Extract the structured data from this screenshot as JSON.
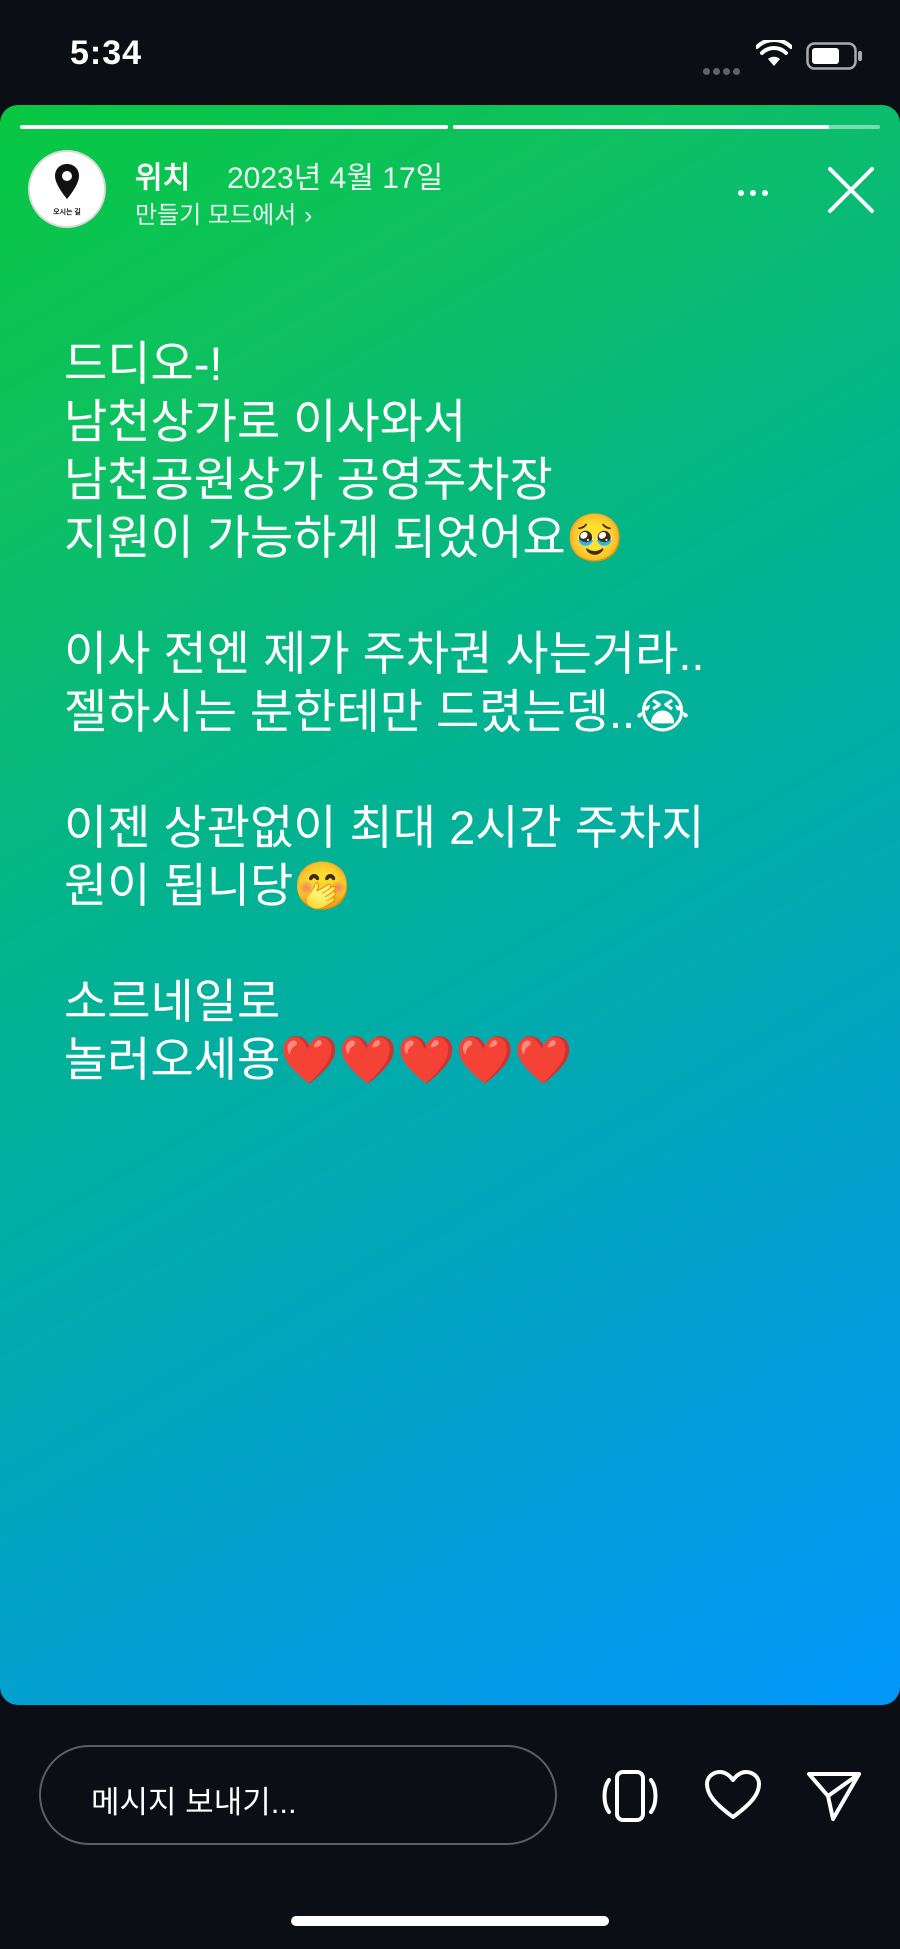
{
  "status_bar": {
    "time": "5:34"
  },
  "story": {
    "progress": [
      1.0,
      0.88
    ],
    "avatar_text": "오시는 길",
    "username": "위치",
    "date": "2023년 4월 17일",
    "subline": "만들기 모드에서",
    "lines": [
      "드디오-!",
      "남천상가로 이사와서",
      "남천공원상가 공영주차장",
      "지원이 가능하게 되었어요🥹",
      "",
      "이사 전엔 제가 주차권 사는거라..",
      "젤하시는 분한테만 드렸는뎅..😭",
      "",
      "이젠 상관없이 최대 2시간 주차지",
      "원이 됩니당🤭",
      "",
      "소르네일로",
      "놀러오세용❤️❤️❤️❤️❤️"
    ]
  },
  "bottom_bar": {
    "message_placeholder": "메시지 보내기..."
  },
  "icons": [
    "wifi-icon",
    "battery-icon",
    "more-icon",
    "close-icon",
    "location-pin-icon",
    "rotate-device-icon",
    "heart-icon",
    "send-icon"
  ]
}
